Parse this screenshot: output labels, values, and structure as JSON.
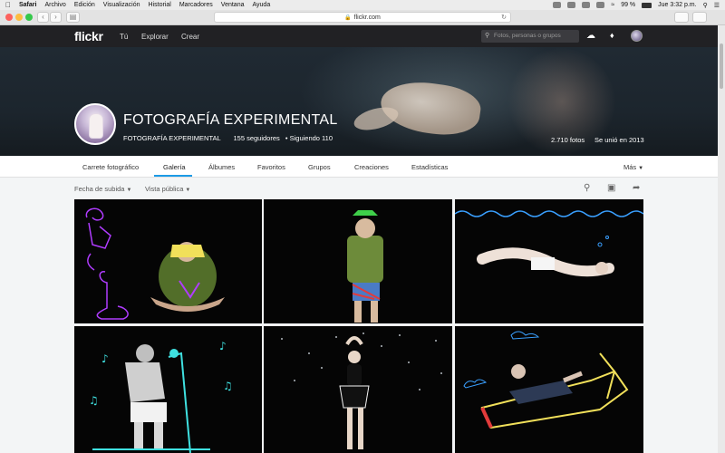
{
  "menubar": {
    "app": "Safari",
    "items": [
      "Archivo",
      "Edición",
      "Visualización",
      "Historial",
      "Marcadores",
      "Ventana",
      "Ayuda"
    ],
    "battery": "99 %",
    "clock": "Jue 3:32 p.m."
  },
  "browser": {
    "url": "flickr.com"
  },
  "header": {
    "logo": "flickr",
    "nav": [
      "Tú",
      "Explorar",
      "Crear"
    ],
    "search_placeholder": "Fotos, personas o grupos"
  },
  "profile": {
    "title": "FOTOGRAFÍA EXPERIMENTAL",
    "username": "FOTOGRAFÍA EXPERIMENTAL",
    "followers": "155 seguidores",
    "following": "Siguiendo 110",
    "photos_count": "2.710 fotos",
    "joined": "Se unió en 2013"
  },
  "tabs": {
    "items": [
      "Carrete fotográfico",
      "Galería",
      "Álbumes",
      "Favoritos",
      "Grupos",
      "Creaciones",
      "Estadísticas"
    ],
    "active": "Galería",
    "more": "Más"
  },
  "filters": {
    "sort": "Fecha de subida",
    "view": "Vista pública"
  },
  "colors": {
    "accent": "#1c9be6",
    "header_bg": "#212124",
    "neon_purple": "#b03cff",
    "neon_cyan": "#3fe0e0",
    "neon_yellow": "#f1e05a",
    "neon_blue": "#3aa0ff"
  }
}
